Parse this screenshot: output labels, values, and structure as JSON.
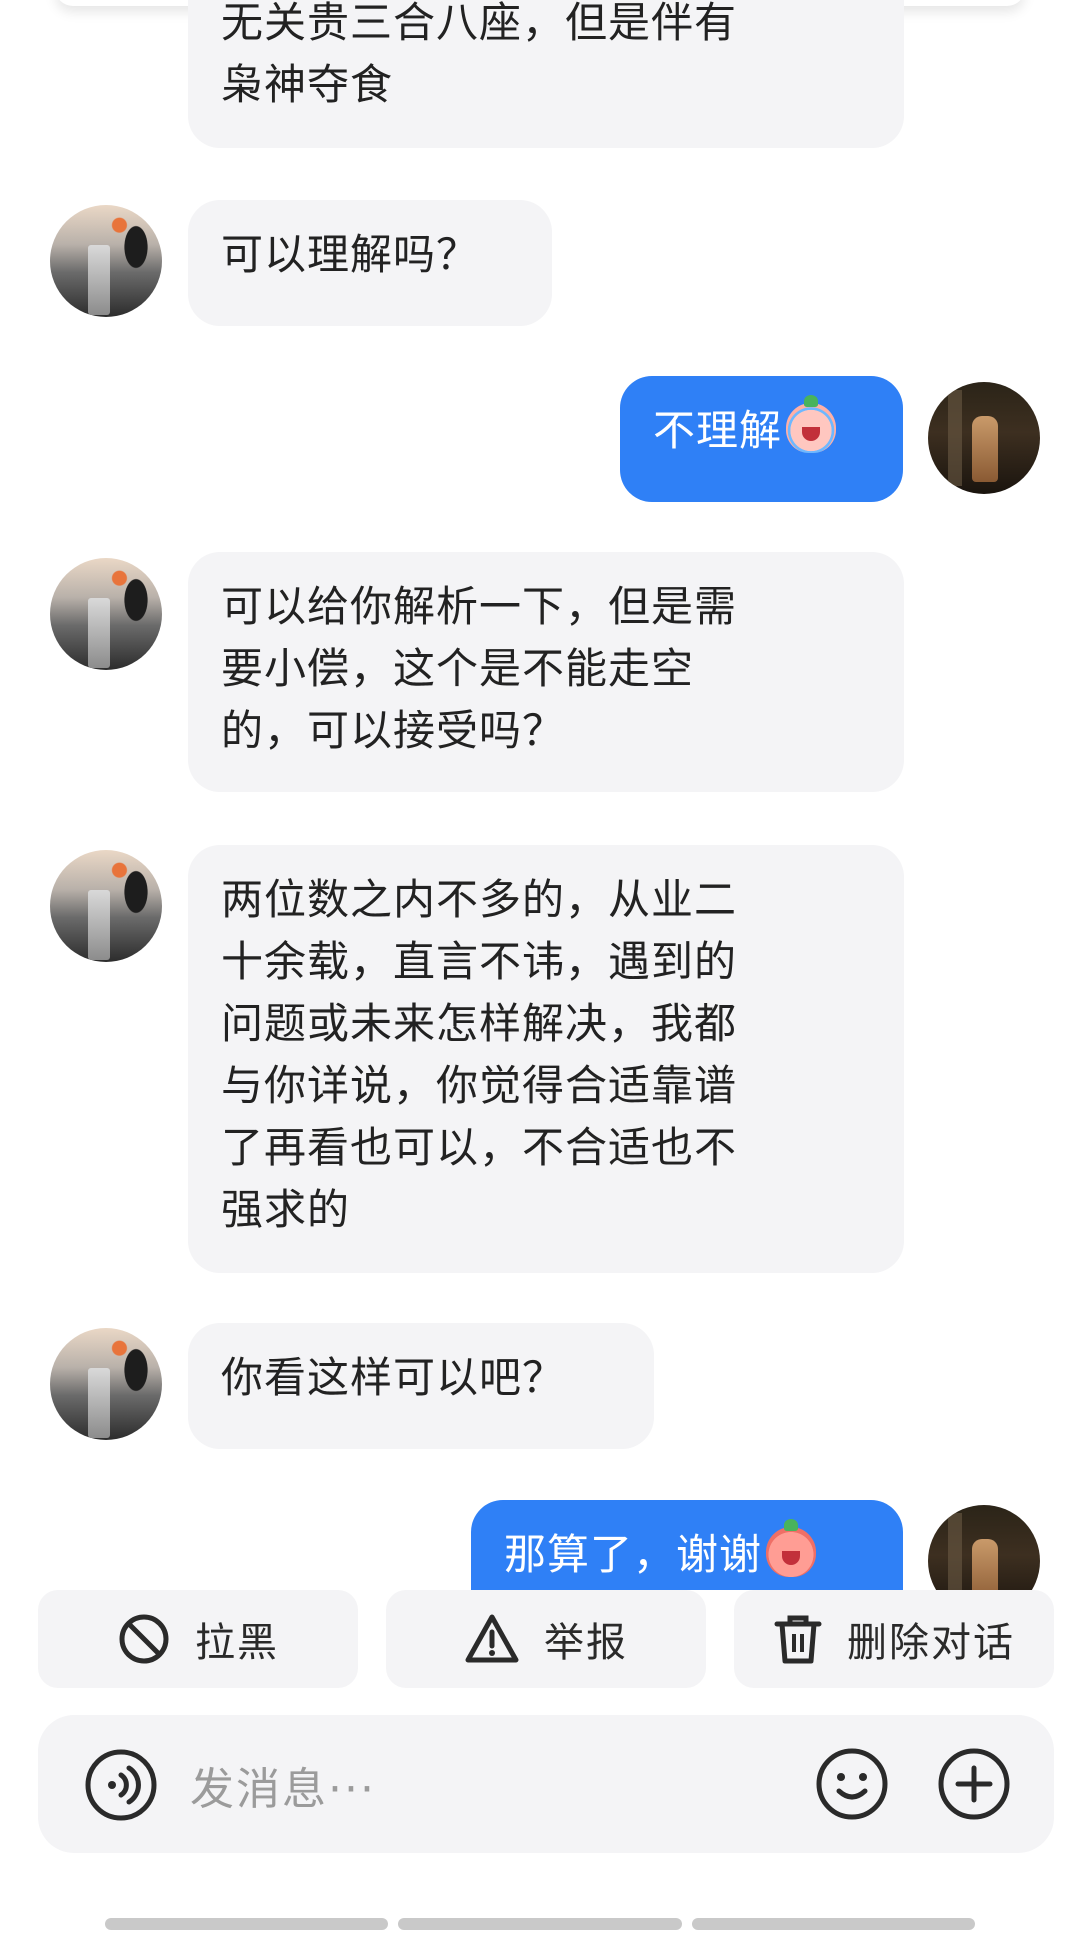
{
  "messages": [
    {
      "side": "other",
      "lines": [
        "无关贵三合八座，但是伴有",
        "枭神夺食"
      ]
    },
    {
      "side": "other",
      "text": "可以理解吗？"
    },
    {
      "side": "me",
      "text": "不理解",
      "emoji": "crying-face-emoji"
    },
    {
      "side": "other",
      "lines": [
        "可以给你解析一下，但是需",
        "要小偿，这个是不能走空",
        "的，可以接受吗？"
      ]
    },
    {
      "side": "other",
      "lines": [
        "两位数之内不多的，从业二",
        "十余载，直言不讳，遇到的",
        "问题或未来怎样解决，我都",
        "与你详说，你觉得合适靠谱",
        "了再看也可以，不合适也不",
        "强求的"
      ]
    },
    {
      "side": "other",
      "text": "你看这样可以吧？"
    },
    {
      "side": "me",
      "text": "那算了，谢谢",
      "emoji": "laughing-face-emoji"
    }
  ],
  "actions": {
    "block": {
      "label": "拉黑",
      "icon": "block-icon"
    },
    "report": {
      "label": "举报",
      "icon": "warning-icon"
    },
    "delete": {
      "label": "删除对话",
      "icon": "trash-icon"
    }
  },
  "composer": {
    "placeholder": "发消息···",
    "voice_icon": "voice-icon",
    "emoji_icon": "smile-icon",
    "plus_icon": "plus-icon"
  }
}
